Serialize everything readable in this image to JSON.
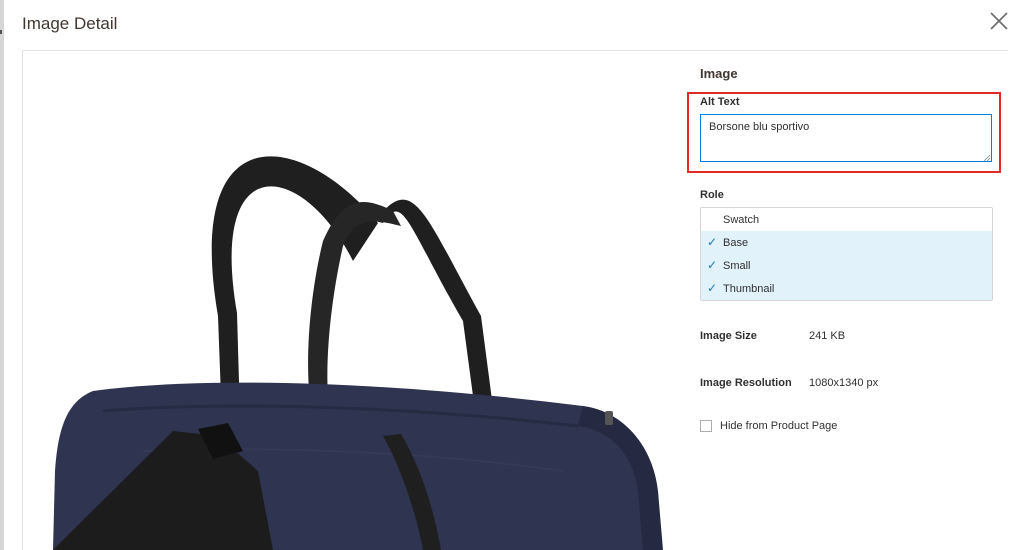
{
  "dialog": {
    "title": "Image Detail",
    "close_icon": "close-icon"
  },
  "image_preview": {
    "subject_colors": {
      "bag": "#2f3450",
      "straps": "#1f1f1f"
    }
  },
  "panel": {
    "section_title": "Image",
    "alt_text": {
      "label": "Alt Text",
      "value": "Borsone blu sportivo",
      "highlight_color": "#e02b27"
    },
    "role": {
      "label": "Role",
      "options": [
        {
          "label": "Swatch",
          "selected": false
        },
        {
          "label": "Base",
          "selected": true
        },
        {
          "label": "Small",
          "selected": true
        },
        {
          "label": "Thumbnail",
          "selected": true
        }
      ],
      "check_glyph": "✓"
    },
    "image_size": {
      "label": "Image Size",
      "value": "241 KB"
    },
    "image_resolution": {
      "label": "Image Resolution",
      "value": "1080x1340 px"
    },
    "hide_from_product_page": {
      "label": "Hide from Product Page",
      "checked": false
    }
  }
}
